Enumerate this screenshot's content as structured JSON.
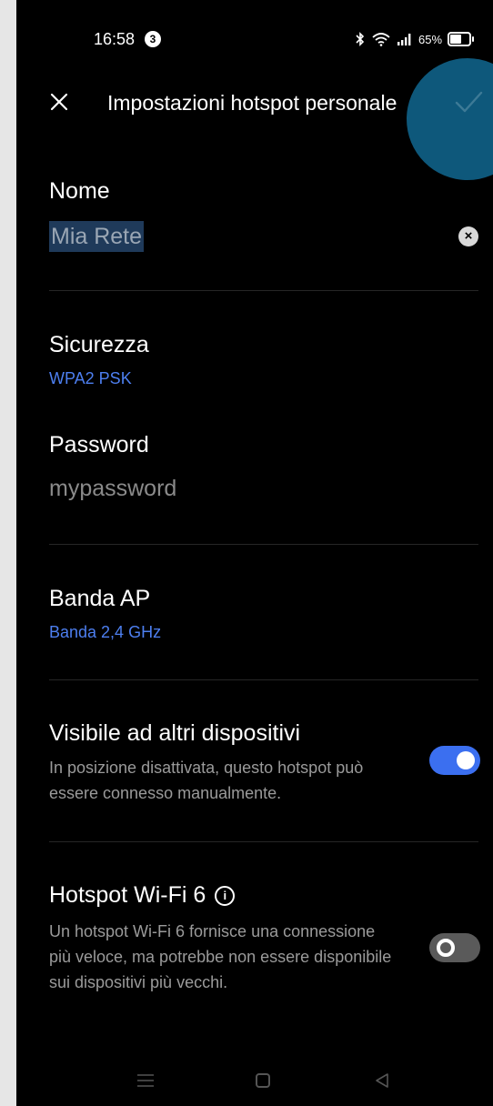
{
  "status_bar": {
    "time": "16:58",
    "notification_count": "3",
    "battery_percent": "65%",
    "battery_level": 0.65
  },
  "header": {
    "title": "Impostazioni hotspot personale"
  },
  "nome": {
    "label": "Nome",
    "value": "Mia Rete"
  },
  "sicurezza": {
    "label": "Sicurezza",
    "value": "WPA2 PSK"
  },
  "password": {
    "label": "Password",
    "value": "mypassword"
  },
  "banda": {
    "label": "Banda AP",
    "value": "Banda 2,4 GHz"
  },
  "visibile": {
    "label": "Visibile ad altri dispositivi",
    "description": "In posizione disattivata, questo hotspot può essere connesso manualmente.",
    "enabled": true
  },
  "wifi6": {
    "label": "Hotspot Wi-Fi 6",
    "description": "Un hotspot Wi-Fi 6 fornisce una connessione più veloce, ma potrebbe non essere disponibile sui dispositivi più vecchi.",
    "enabled": false
  },
  "colors": {
    "accent": "#3b6ff0",
    "link_blue": "#4d7ff0",
    "tap_overlay": "#0f5f86"
  },
  "icons": [
    "bluetooth-icon",
    "wifi-icon",
    "signal-icon",
    "battery-icon",
    "close-icon",
    "check-icon",
    "clear-icon",
    "info-icon",
    "menu-icon",
    "home-icon",
    "back-icon"
  ]
}
